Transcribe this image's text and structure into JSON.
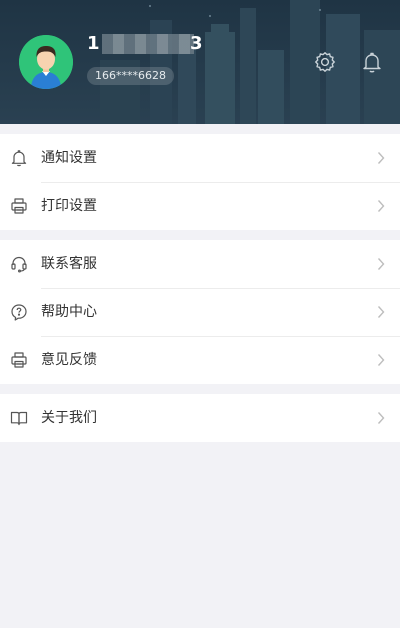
{
  "header": {
    "user_name_prefix": "1",
    "user_name_suffix": "3",
    "phone": "166****6628",
    "colors": {
      "background": "#1f3444",
      "avatar_bg": "#2fc479"
    }
  },
  "icons": {
    "settings": "gear-icon",
    "notify": "bell-icon"
  },
  "groups": [
    {
      "items": [
        {
          "label": "通知设置",
          "icon": "bell-icon"
        },
        {
          "label": "打印设置",
          "icon": "printer-icon"
        }
      ]
    },
    {
      "items": [
        {
          "label": "联系客服",
          "icon": "headset-icon"
        },
        {
          "label": "帮助中心",
          "icon": "help-icon"
        },
        {
          "label": "意见反馈",
          "icon": "printer-icon"
        }
      ]
    },
    {
      "items": [
        {
          "label": "关于我们",
          "icon": "book-icon"
        }
      ]
    }
  ]
}
